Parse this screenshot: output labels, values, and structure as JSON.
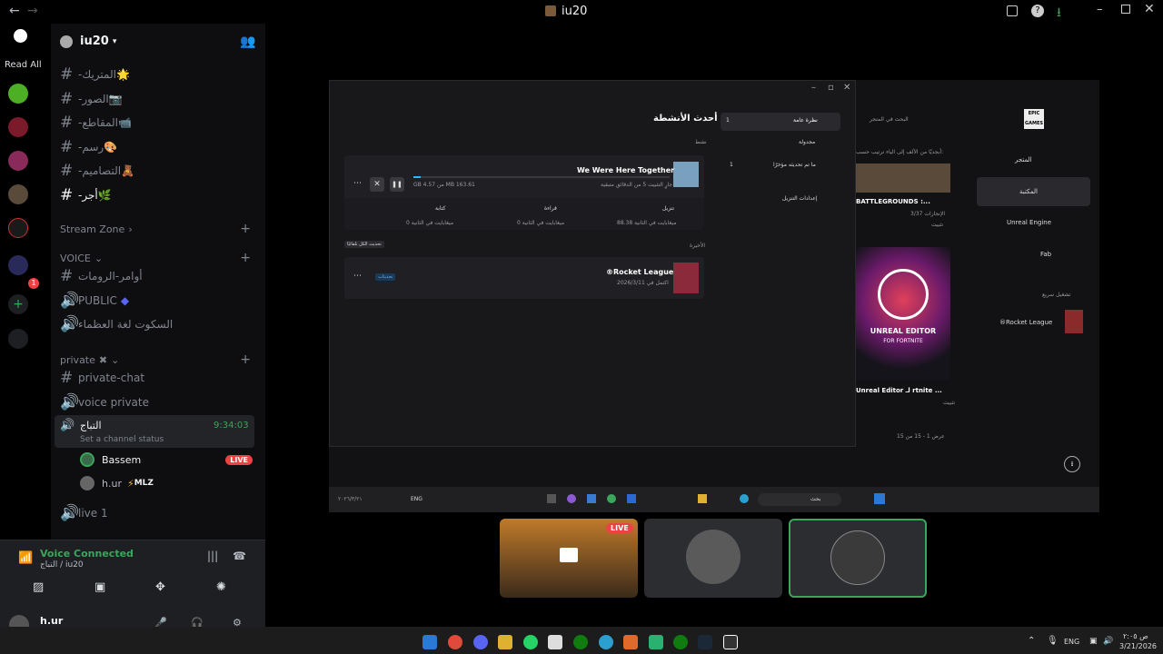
{
  "titlebar": {
    "back": "←",
    "forward": "→",
    "app_title": "iu20"
  },
  "rail": {
    "read_all": "Read All",
    "badge_count": "1"
  },
  "server": {
    "name": "iu20"
  },
  "channels": [
    {
      "name": "-المتريك",
      "emoji": "🌟"
    },
    {
      "name": "-الصور",
      "emoji": "📷"
    },
    {
      "name": "-المقاطع",
      "emoji": "📹"
    },
    {
      "name": "-رسم",
      "emoji": "🎨"
    },
    {
      "name": "-التصاميم",
      "emoji": "🧸"
    },
    {
      "name": "-أجر",
      "emoji": "🌿"
    }
  ],
  "categories": {
    "stream_zone": "Stream Zone",
    "voice": "VOICE",
    "private": "private"
  },
  "voice_channels": [
    {
      "name": "أوامر-الرومات"
    },
    {
      "name": "PUBLIC"
    },
    {
      "name": "السكوت لغة العظماء"
    }
  ],
  "private_channels": [
    {
      "name": "private-chat"
    },
    {
      "name": "voice private"
    }
  ],
  "active_voice": {
    "name": "التباج",
    "time": "9:34:03",
    "status": "Set a channel status",
    "members": [
      {
        "name": "Bassem",
        "badge": "LIVE"
      },
      {
        "name": "h.ur",
        "tag": "MLZ"
      }
    ]
  },
  "live1": "live 1",
  "voice_connected": {
    "title": "Voice Connected",
    "sub": "التباج / iu20"
  },
  "user": {
    "name": "h.ur"
  },
  "shared_screen": {
    "downloads_title": "أحدث الأنشطة",
    "nav": [
      {
        "label": "نظرة عامة",
        "count": "1"
      },
      {
        "label": "مجدولة"
      },
      {
        "label": "ما تم تحديثه مؤخرًا",
        "count": "1"
      },
      {
        "label": "إعدادات التنزيل"
      }
    ],
    "active_label": "نشط",
    "game1": {
      "name": "We Were Here Together",
      "progress_text": "GB 4.57 من MB 163.61",
      "status": "جارٍ التثبيت 5 من الدقائق متبقية",
      "stats": [
        {
          "label": "تنزيل",
          "value": "88.38 ميغابايت في الثانية"
        },
        {
          "label": "قراءة",
          "value": "0 ميغابايت في الثانية"
        },
        {
          "label": "كتابة",
          "value": "0 ميغابايت في الثانية"
        }
      ]
    },
    "recent_label": "الأخيرة",
    "update_all": "تحديث الكل تلقائيًا",
    "game2": {
      "name": "®Rocket League",
      "date": "اكتمل في 2026/3/11",
      "tag": "تحديثات"
    },
    "store_search": "البحث في المتجر",
    "sort_label": "ترتيب حسب:",
    "sort_value": "أبجديًا من الألف إلى الياء",
    "battlegrounds": "BATTLEGROUNDS :...",
    "battlegrounds_sub": "3/37 الإنجازات",
    "install": "تثبيت",
    "unreal_title": "UNREAL EDITOR",
    "unreal_sub": "FOR FORTNITE",
    "unreal_caption": "Unreal Editor لـ rtnite ...",
    "results": "عرض 1 - 15 من 15",
    "sidebar": [
      {
        "label": "المتجر"
      },
      {
        "label": "المكتبة"
      },
      {
        "label": "Unreal Engine"
      },
      {
        "label": "Fab"
      }
    ],
    "quick_launch": "تشغيل سريع",
    "quick_game": "®Rocket League",
    "epic": "EPIC GAMES",
    "inner_search": "بحث",
    "inner_lang": "ENG",
    "inner_date": "٢٠٢٦/٣/٢١"
  },
  "tiles": [
    {
      "badge": "LIVE"
    }
  ],
  "taskbar": {
    "lang": "ENG",
    "time": "ص ٢:٠٥",
    "date": "3/21/2026"
  }
}
